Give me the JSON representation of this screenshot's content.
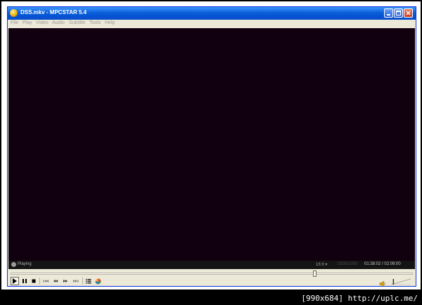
{
  "window": {
    "title": "DSS.mkv - MPCSTAR 5.4"
  },
  "menu": [
    "File",
    "Play",
    "Video",
    "Audio",
    "Subtitle",
    "Tools",
    "Help"
  ],
  "status": {
    "state": "Playing",
    "aspect": "16:9 ▾",
    "resolution": "1920x1080",
    "time": "01:38:02 / 02:09:00"
  },
  "seek": {
    "position_fraction": 0.76
  },
  "volume": {
    "level_fraction": 0.1
  },
  "watermark": "[990x684] http://uplc.me/",
  "icons": {
    "play": "play-icon",
    "pause": "pause-icon",
    "stop": "stop-icon",
    "prev": "previous-icon",
    "rewind": "rewind-icon",
    "forward": "fast-forward-icon",
    "next": "next-icon",
    "playlist": "playlist-icon",
    "skin": "skin-color-icon",
    "volume": "speaker-icon"
  }
}
